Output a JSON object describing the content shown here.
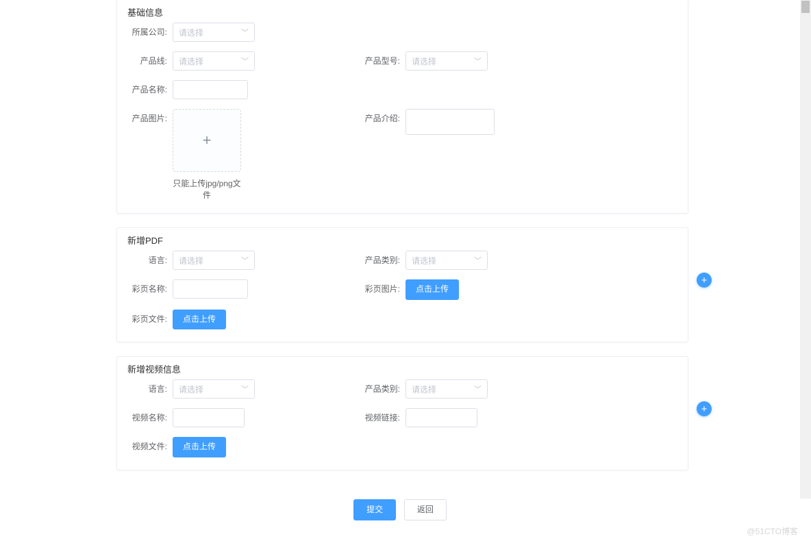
{
  "watermark": "@51CTO博客",
  "placeholders": {
    "select": "请选择"
  },
  "actions": {
    "upload": "点击上传",
    "submit": "提交",
    "back": "返回"
  },
  "section1": {
    "title": "基础信息",
    "fields": {
      "company": "所属公司:",
      "productLine": "产品线:",
      "productModel": "产品型号:",
      "productName": "产品名称:",
      "productImage": "产品图片:",
      "productIntro": "产品介绍:"
    },
    "uploadHint": "只能上传jpg/png文件"
  },
  "section2": {
    "title": "新增PDF",
    "fields": {
      "language": "语言:",
      "category": "产品类别:",
      "pageName": "彩页名称:",
      "pageImage": "彩页图片:",
      "pageFile": "彩页文件:"
    }
  },
  "section3": {
    "title": "新增视频信息",
    "fields": {
      "language": "语言:",
      "category": "产品类别:",
      "videoName": "视频名称:",
      "videoLink": "视频链接:",
      "videoFile": "视频文件:"
    }
  }
}
